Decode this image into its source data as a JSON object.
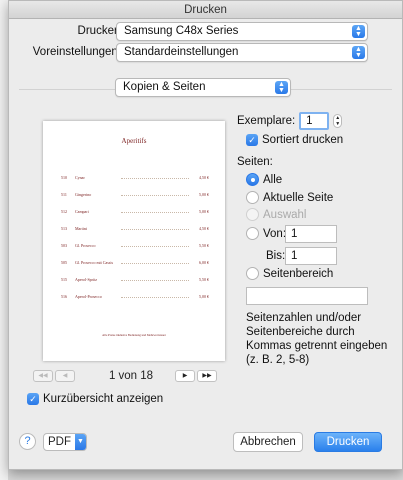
{
  "window": {
    "title": "Drucken"
  },
  "printer": {
    "label": "Drucker:",
    "value": "Samsung C48x Series"
  },
  "presets": {
    "label": "Voreinstellungen:",
    "value": "Standardeinstellungen"
  },
  "section": {
    "value": "Kopien & Seiten"
  },
  "preview": {
    "page_title": "Aperitifs",
    "items": [
      {
        "num": "510",
        "name": "Cynar",
        "price": "4,50 €"
      },
      {
        "num": "511",
        "name": "Gingerino",
        "price": "5,00 €"
      },
      {
        "num": "512",
        "name": "Campari",
        "price": "5,00 €"
      },
      {
        "num": "513",
        "name": "Martini",
        "price": "4,50 €"
      },
      {
        "num": "503",
        "name": "Gl. Prosecco",
        "price": "5,50 €"
      },
      {
        "num": "505",
        "name": "Gl. Prosecco mit Cassis",
        "price": "6,00 €"
      },
      {
        "num": "515",
        "name": "Aperol-Spritz",
        "price": "5,50 €"
      },
      {
        "num": "516",
        "name": "Aperol-Prosecco",
        "price": "5,00 €"
      }
    ],
    "footer": "Alle Preise inklusive Bedienung und Mehrwertsteuer"
  },
  "pager": {
    "text": "1 von 18",
    "first": "◀◀",
    "prev": "◀",
    "next": "▶",
    "last": "▶▶"
  },
  "thumbnail_check": {
    "label": "Kurzübersicht anzeigen",
    "checked": true
  },
  "copies": {
    "label": "Exemplare:",
    "value": "1",
    "collate_label": "Sortiert drucken",
    "collate_checked": true
  },
  "pages": {
    "label": "Seiten:",
    "all": "Alle",
    "current": "Aktuelle Seite",
    "selection": "Auswahl",
    "from_label": "Von:",
    "from_value": "1",
    "to_label": "Bis:",
    "to_value": "1",
    "range_label": "Seitenbereich",
    "range_value": "",
    "hint": "Seitenzahlen und/oder Seitenbereiche durch Kommas getrennt eingeben (z. B. 2, 5-8)"
  },
  "footer": {
    "help": "?",
    "pdf": "PDF",
    "cancel": "Abbrechen",
    "print": "Drucken"
  },
  "colors": {
    "accent": "#2a7be3",
    "menu_text": "#7a1e1e"
  }
}
